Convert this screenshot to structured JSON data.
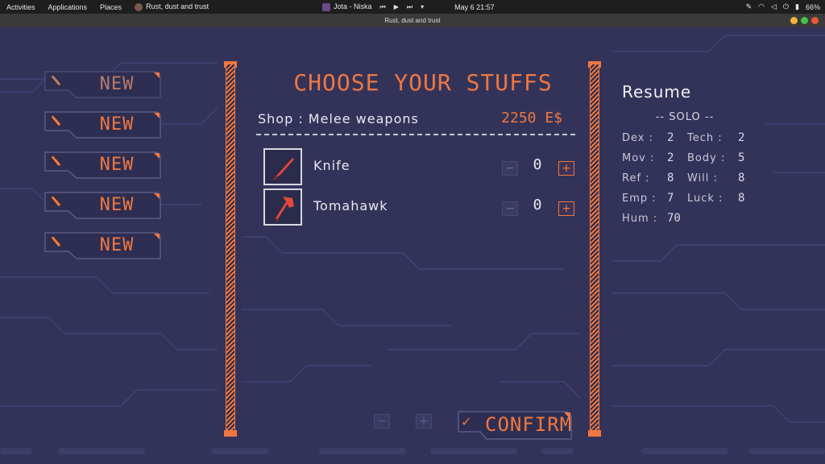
{
  "topbar": {
    "activities": "Activities",
    "applications": "Applications",
    "places": "Places",
    "window_app": "Rust, dust and trust",
    "media": "Jota - Niska",
    "datetime": "May 6  21:57",
    "battery": "66%"
  },
  "window": {
    "title": "Rust, dust and trust"
  },
  "slots": [
    {
      "label": "NEW"
    },
    {
      "label": "NEW"
    },
    {
      "label": "NEW"
    },
    {
      "label": "NEW"
    },
    {
      "label": "NEW"
    }
  ],
  "shop": {
    "title": "CHOOSE YOUR STUFFS",
    "name": "Shop : Melee weapons",
    "money": "2250 E$",
    "items": [
      {
        "name": "Knife",
        "quantity": "0",
        "icon": "knife-icon"
      },
      {
        "name": "Tomahawk",
        "quantity": "0",
        "icon": "tomahawk-icon"
      }
    ],
    "minus": "−",
    "plus": "+",
    "confirm": "CONFIRM",
    "confirm_check": "✓"
  },
  "resume": {
    "title": "Resume",
    "role": "-- SOLO --",
    "stats": [
      {
        "label": "Dex :",
        "value": "2"
      },
      {
        "label": "Tech :",
        "value": "2"
      },
      {
        "label": "Mov :",
        "value": "2"
      },
      {
        "label": "Body :",
        "value": "5"
      },
      {
        "label": "Ref :",
        "value": "8"
      },
      {
        "label": "Will :",
        "value": "8"
      },
      {
        "label": "Emp :",
        "value": "7"
      },
      {
        "label": "Luck :",
        "value": "8"
      },
      {
        "label": "Hum :",
        "value": "70"
      }
    ]
  },
  "colors": {
    "accent": "#f0773f",
    "background": "#33335a",
    "text": "#e8e8f0"
  }
}
